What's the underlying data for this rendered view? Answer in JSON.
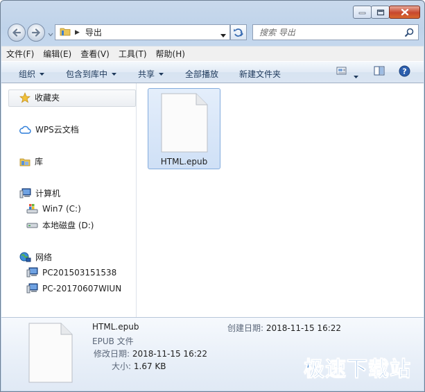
{
  "address": {
    "crumb": "导出"
  },
  "search": {
    "placeholder": "搜索 导出"
  },
  "menu": [
    "文件(F)",
    "编辑(E)",
    "查看(V)",
    "工具(T)",
    "帮助(H)"
  ],
  "toolbar": {
    "organize": "组织",
    "include": "包含到库中",
    "share": "共享",
    "play_all": "全部播放",
    "new_folder": "新建文件夹"
  },
  "nav": {
    "favorites": "收藏夹",
    "wps": "WPS云文档",
    "library": "库",
    "computer": "计算机",
    "drive_c": "Win7 (C:)",
    "drive_d": "本地磁盘 (D:)",
    "network": "网络",
    "pc1": "PC201503151538",
    "pc2": "PC-20170607WIUN"
  },
  "files": [
    {
      "name": "HTML.epub"
    }
  ],
  "details": {
    "name": "HTML.epub",
    "type": "EPUB 文件",
    "modified_label": "修改日期:",
    "modified_value": "2018-11-15 16:22",
    "size_label": "大小:",
    "size_value": "1.67 KB",
    "created_label": "创建日期:",
    "created_value": "2018-11-15 16:22"
  },
  "watermark": "极速下载站",
  "colors": {
    "accent": "#1f6dc8",
    "selection": "#cfe0f6",
    "close": "#c7472d"
  }
}
